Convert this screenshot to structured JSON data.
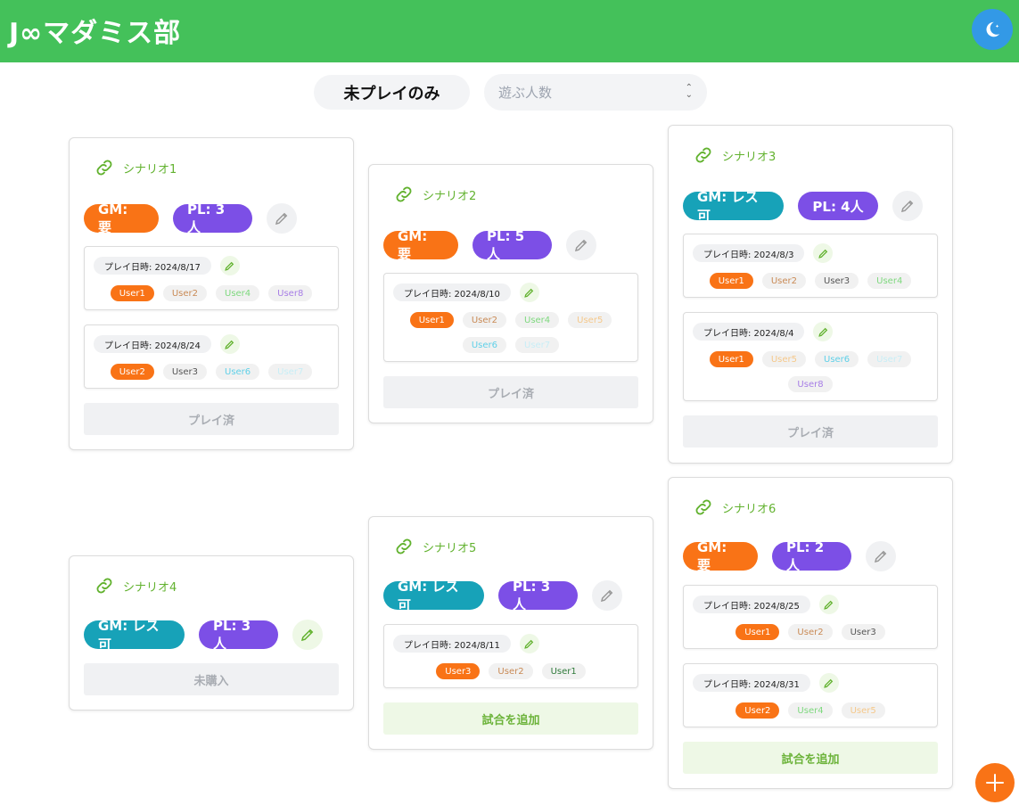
{
  "app": {
    "title": "J∞マダミス部"
  },
  "filters": {
    "unplayed_label": "未プレイのみ",
    "players_placeholder": "遊ぶ人数"
  },
  "colors": {
    "header": "#44c15a",
    "gm_required": "#f97316",
    "gm_less": "#17a2b8",
    "pl": "#7c4fe6",
    "accent": "#62b22f"
  },
  "cards": [
    {
      "name": "シナリオ1",
      "gm": "GM: 要",
      "pl": "PL: 3人",
      "sessions": [
        {
          "date": "プレイ日時: 2024/8/17",
          "users": [
            "User1",
            "User2",
            "User4",
            "User8"
          ]
        },
        {
          "date": "プレイ日時: 2024/8/24",
          "users": [
            "User2",
            "User3",
            "User6",
            "User7"
          ]
        }
      ],
      "action": "プレイ済"
    },
    {
      "name": "シナリオ2",
      "gm": "GM: 要",
      "pl": "PL: 5人",
      "sessions": [
        {
          "date": "プレイ日時: 2024/8/10",
          "users": [
            "User1",
            "User2",
            "User4",
            "User5",
            "User6",
            "User7"
          ]
        }
      ],
      "action": "プレイ済"
    },
    {
      "name": "シナリオ3",
      "gm": "GM: レス可",
      "pl": "PL: 4人",
      "sessions": [
        {
          "date": "プレイ日時: 2024/8/3",
          "users": [
            "User1",
            "User2",
            "User3",
            "User4"
          ]
        },
        {
          "date": "プレイ日時: 2024/8/4",
          "users": [
            "User1",
            "User5",
            "User6",
            "User7",
            "User8"
          ]
        }
      ],
      "action": "プレイ済"
    },
    {
      "name": "シナリオ4",
      "gm": "GM: レス可",
      "pl": "PL: 3人",
      "sessions": [],
      "action": "未購入"
    },
    {
      "name": "シナリオ5",
      "gm": "GM: レス可",
      "pl": "PL: 3人",
      "sessions": [
        {
          "date": "プレイ日時: 2024/8/11",
          "users": [
            "User3",
            "User2",
            "User1"
          ]
        }
      ],
      "action": "試合を追加"
    },
    {
      "name": "シナリオ6",
      "gm": "GM: 要",
      "pl": "PL: 2人",
      "sessions": [
        {
          "date": "プレイ日時: 2024/8/25",
          "users": [
            "User1",
            "User2",
            "User3"
          ]
        },
        {
          "date": "プレイ日時: 2024/8/31",
          "users": [
            "User2",
            "User4",
            "User5"
          ]
        }
      ],
      "action": "試合を追加"
    }
  ],
  "icons": {
    "theme": "moon-icon",
    "link": "link-icon",
    "edit": "pencil-icon",
    "add": "plus-icon"
  }
}
